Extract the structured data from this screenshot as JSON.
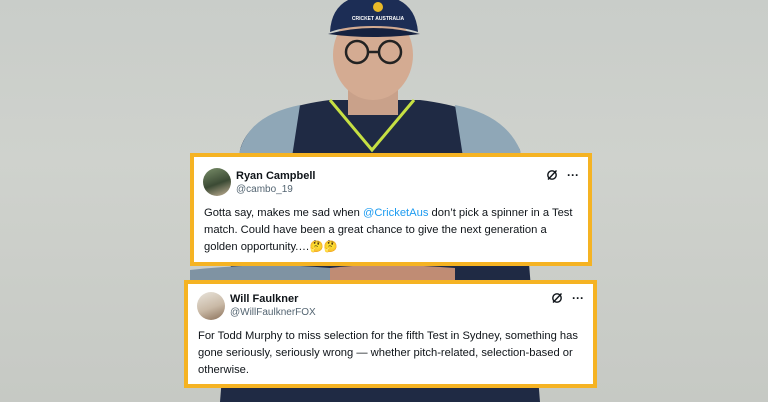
{
  "tweets": [
    {
      "name": "Ryan Campbell",
      "handle": "@cambo_19",
      "text_before": "Gotta say, makes me sad when ",
      "mention": "@CricketAus",
      "text_after": " don’t pick a spinner in a Test match. Could have been a great chance to give the next generation a golden opportunity.…",
      "emoji": "🤔🤔"
    },
    {
      "name": "Will Faulkner",
      "handle": "@WillFaulknerFOX",
      "text": "For Todd Murphy to miss selection for the fifth Test in Sydney, something has gone seriously, seriously wrong — whether pitch-related, selection-based or otherwise."
    }
  ],
  "cap_text": "CRICKET AUSTRALIA",
  "colors": {
    "border": "#f5b323",
    "mention": "#1d9bf0",
    "handle": "#536471"
  },
  "icons": [
    "grok-icon",
    "more-icon"
  ]
}
